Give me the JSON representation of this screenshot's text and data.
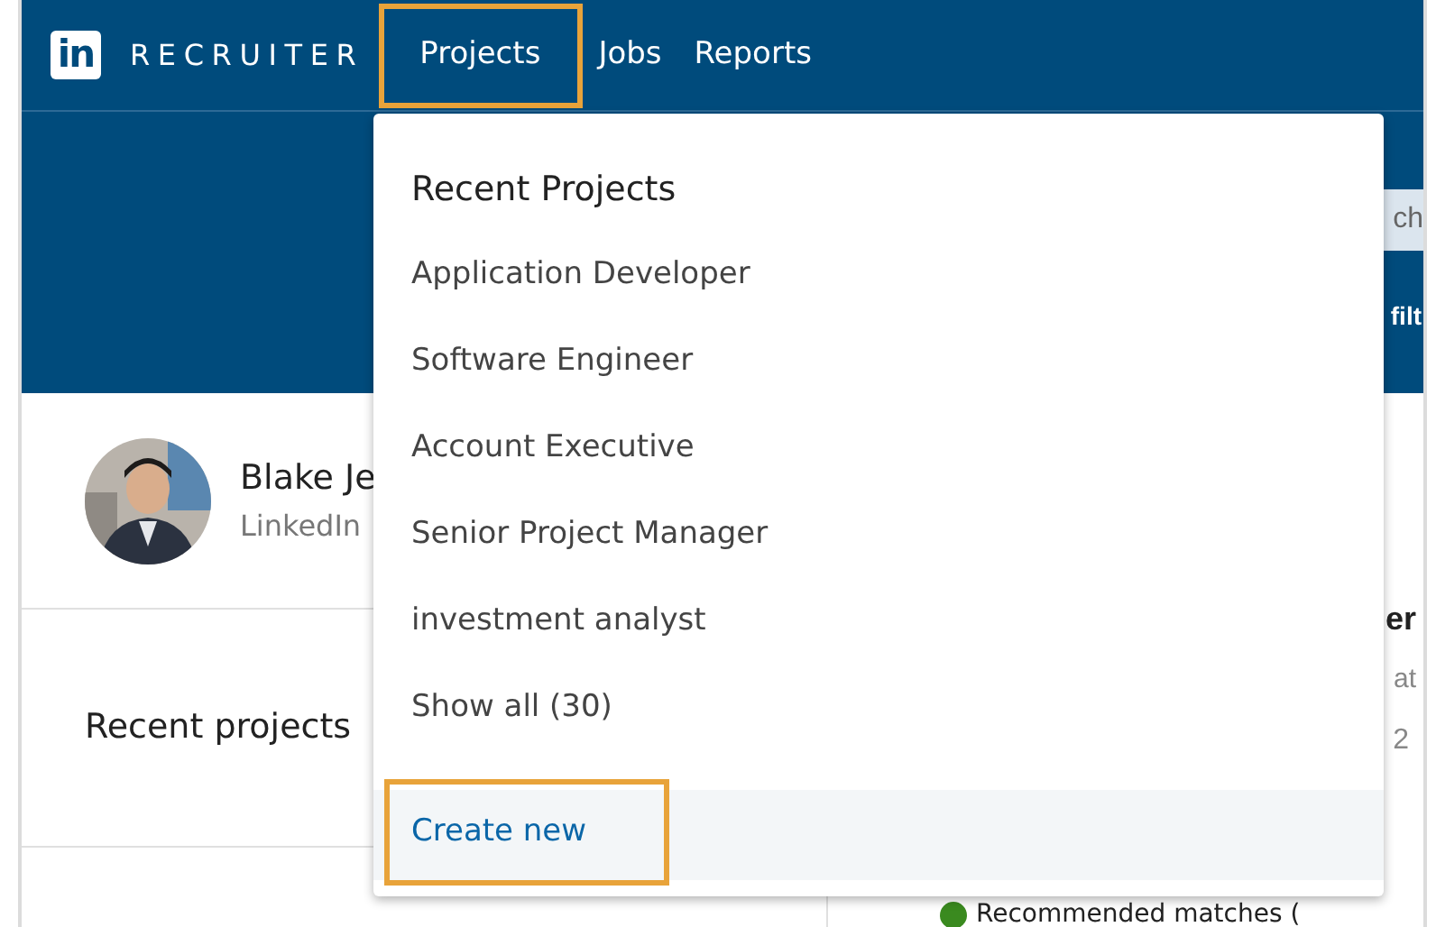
{
  "header": {
    "logo_mark": "in",
    "logo_text": "RECRUITER",
    "nav": [
      {
        "label": "Projects",
        "highlighted": true
      },
      {
        "label": "Jobs",
        "highlighted": false
      },
      {
        "label": "Reports",
        "highlighted": false
      }
    ]
  },
  "banner": {
    "search_text": "ch",
    "filter_text": "filt"
  },
  "profile": {
    "name": "Blake Je",
    "company": "LinkedIn"
  },
  "recent_projects": {
    "title": "Recent projects"
  },
  "right_panel": {
    "title": "er",
    "subtitle": "at",
    "count": "2",
    "status": {
      "label": "Recommended matches (",
      "color": "#3a8a1f"
    }
  },
  "dropdown": {
    "heading": "Recent Projects",
    "items": [
      {
        "label": "Application Developer"
      },
      {
        "label": "Software Engineer"
      },
      {
        "label": "Account Executive"
      },
      {
        "label": "Senior Project Manager"
      },
      {
        "label": "investment analyst"
      },
      {
        "label": "Show all (30)"
      }
    ],
    "footer": {
      "label": "Create new",
      "highlighted": true
    }
  }
}
